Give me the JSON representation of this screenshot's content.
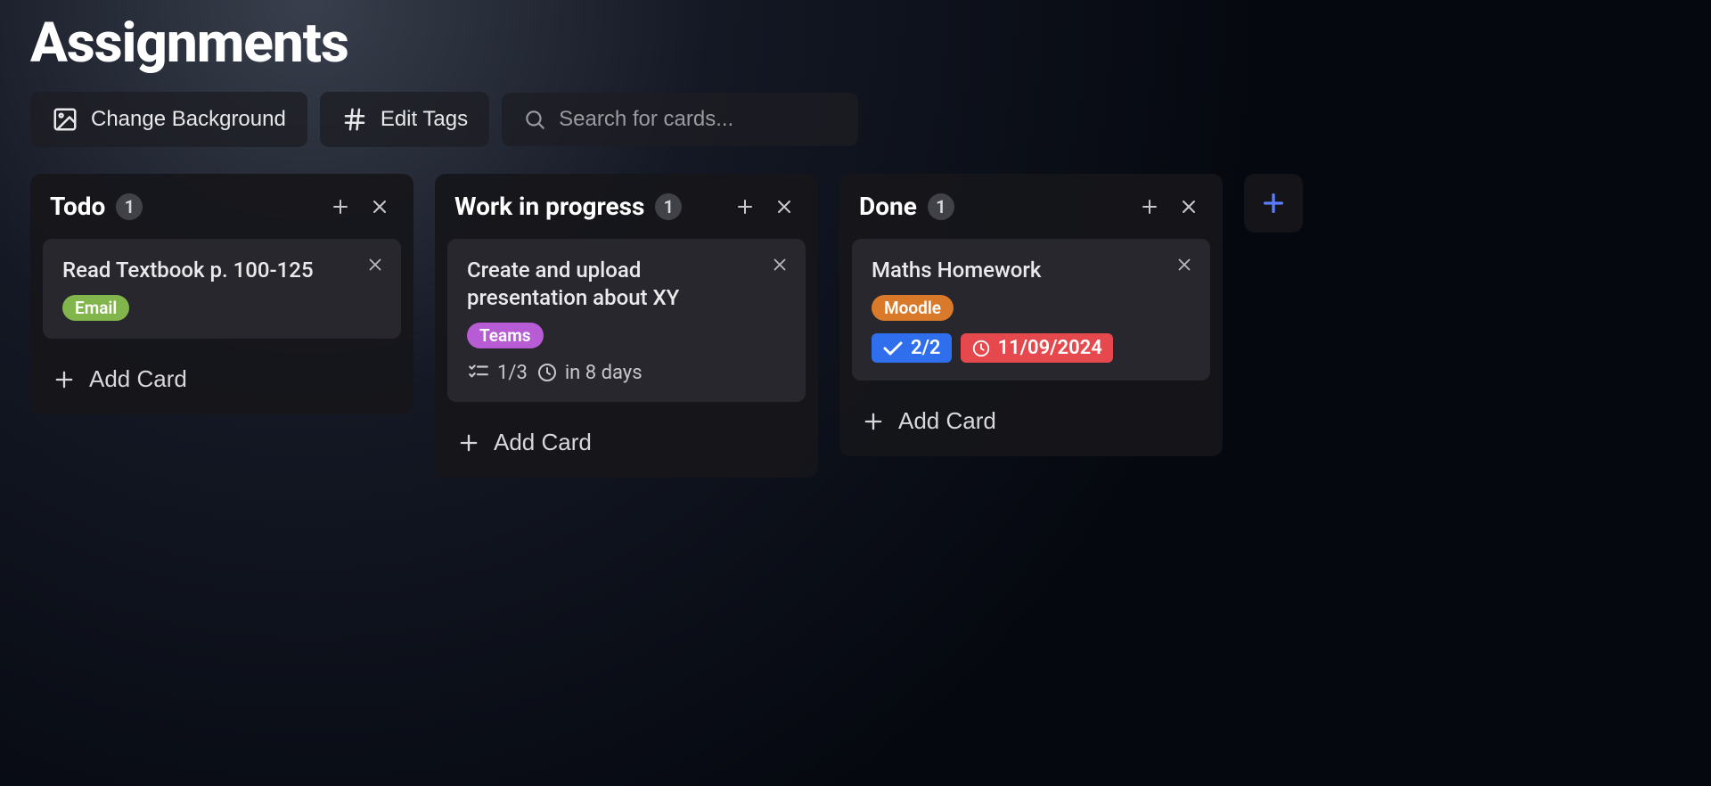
{
  "board": {
    "title": "Assignments"
  },
  "toolbar": {
    "change_bg": "Change Background",
    "edit_tags": "Edit Tags",
    "search_placeholder": "Search for cards..."
  },
  "add_card_label": "Add Card",
  "columns": [
    {
      "title": "Todo",
      "count": "1",
      "cards": [
        {
          "title": "Read Textbook p. 100-125",
          "tags": [
            {
              "label": "Email",
              "color": "#82b54b"
            }
          ]
        }
      ]
    },
    {
      "title": "Work in progress",
      "count": "1",
      "cards": [
        {
          "title": "Create and upload presentation about XY",
          "tags": [
            {
              "label": "Teams",
              "color": "#b85cd6"
            }
          ],
          "checklist": "1/3",
          "due_label": "in 8 days"
        }
      ]
    },
    {
      "title": "Done",
      "count": "1",
      "cards": [
        {
          "title": "Maths Homework",
          "tags": [
            {
              "label": "Moodle",
              "color": "#d97a2b"
            }
          ],
          "checklist_pill": {
            "label": "2/2",
            "color": "#2f6fed"
          },
          "date_pill": {
            "label": "11/09/2024",
            "color": "#e5484d"
          }
        }
      ]
    }
  ]
}
